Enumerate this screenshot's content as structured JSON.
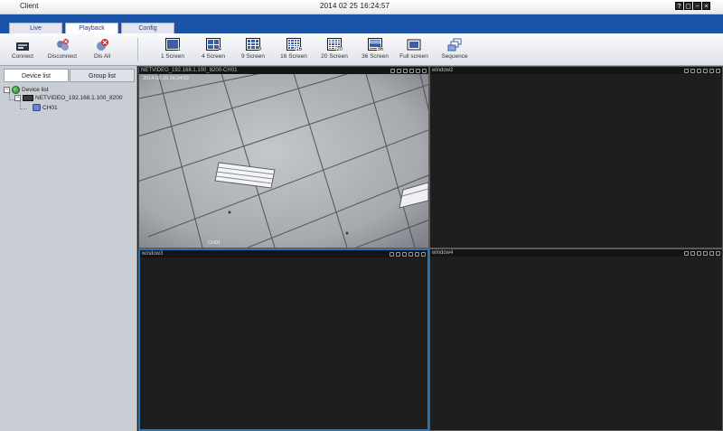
{
  "window": {
    "title": "Client",
    "datetime": "2014 02 25 16:24:57",
    "buttons": [
      "?",
      "▢",
      "−",
      "×"
    ]
  },
  "tabs": [
    {
      "label": "Live",
      "active": false
    },
    {
      "label": "Playback",
      "active": true
    },
    {
      "label": "Config",
      "active": false
    }
  ],
  "toolbar": {
    "connect": "Connect",
    "disconnect": "Disconnect",
    "dis_all": "Dis All",
    "screen1": "1 Screen",
    "screen4": "4 Screen",
    "screen9": "9 Screen",
    "screen16": "16 Screen",
    "screen20": "20 Screen",
    "screen36": "36 Screen",
    "fullscreen": "Full screen",
    "sequence": "Sequence"
  },
  "left": {
    "device_tab": "Device list",
    "group_tab": "Group list",
    "tree": {
      "root": "Device list",
      "device": "NETVIDEO_192.168.1.100_8200",
      "channel": "CH01"
    }
  },
  "panes": [
    {
      "title": "NETVIDEO_192.168.1.100_8200-CH01",
      "osd": "2014-02-25 16:24:52",
      "osd2": "CH01"
    },
    {
      "title": "window2"
    },
    {
      "title": "window3"
    },
    {
      "title": "window4"
    }
  ],
  "colors": {
    "tabbar": "#1b53a6",
    "selected_pane": "#2a76b8",
    "video_bg": "#1e1e1e"
  }
}
